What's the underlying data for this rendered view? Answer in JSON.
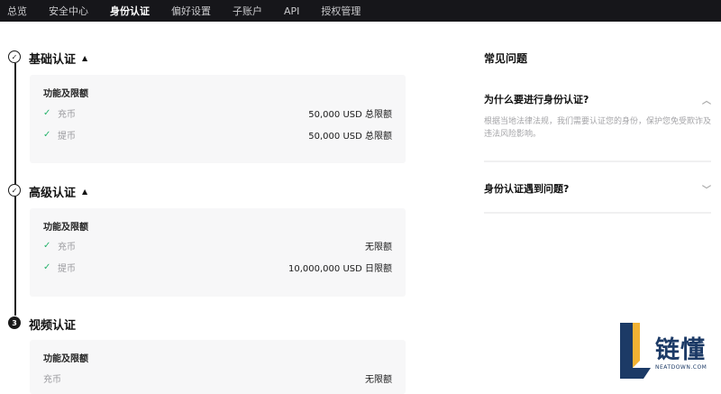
{
  "nav": {
    "tabs": [
      "总览",
      "安全中心",
      "身份认证",
      "偏好设置",
      "子账户",
      "API",
      "授权管理"
    ],
    "active_index": 2
  },
  "steps": [
    {
      "marker": "✓",
      "title": "基础认证",
      "card_title": "功能及限额",
      "rows": [
        {
          "label": "充币",
          "value": "50,000 USD 总限额"
        },
        {
          "label": "提币",
          "value": "50,000 USD 总限额"
        }
      ]
    },
    {
      "marker": "✓",
      "title": "高级认证",
      "card_title": "功能及限额",
      "rows": [
        {
          "label": "充币",
          "value": "无限额"
        },
        {
          "label": "提币",
          "value": "10,000,000 USD 日限额"
        }
      ]
    },
    {
      "marker": "3",
      "title": "视频认证",
      "card_title": "功能及限额",
      "rows": [
        {
          "label": "充币",
          "value": "无限额"
        }
      ]
    }
  ],
  "faq": {
    "title": "常见问题",
    "items": [
      {
        "question": "为什么要进行身份认证?",
        "answer": "根据当地法律法规，我们需要认证您的身份，保护您免受欺诈及违法风险影响。",
        "expanded": true
      },
      {
        "question": "身份认证遇到问题?",
        "expanded": false
      }
    ]
  },
  "watermark": {
    "brand": "链懂",
    "domain": "NEATDOWN.COM"
  },
  "colors": {
    "check_green": "#25b36b",
    "nav_bg": "#16161a",
    "card_bg": "#f7f7f8"
  }
}
